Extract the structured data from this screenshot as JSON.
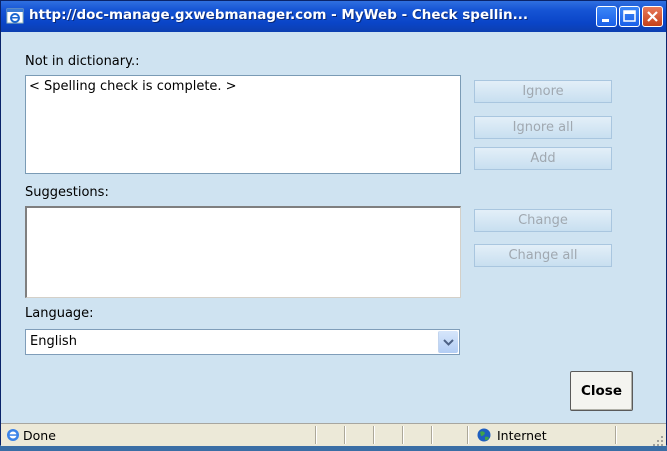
{
  "window": {
    "title": "http://doc-manage.gxwebmanager.com - MyWeb - Check spellin..."
  },
  "labels": {
    "not_in_dictionary": "Not in dictionary.:",
    "suggestions": "Suggestions:",
    "language": "Language:"
  },
  "not_in_dictionary_text": "< Spelling check is complete. >",
  "buttons": {
    "ignore": "Ignore",
    "ignore_all": "Ignore all",
    "add": "Add",
    "change": "Change",
    "change_all": "Change all",
    "close": "Close"
  },
  "language": {
    "selected": "English"
  },
  "statusbar": {
    "status": "Done",
    "zone": "Internet"
  },
  "colors": {
    "dialog_background": "#cfe3f1",
    "titlebar_blue": "#0a45c8",
    "disabled_text": "#a0a8b0"
  }
}
